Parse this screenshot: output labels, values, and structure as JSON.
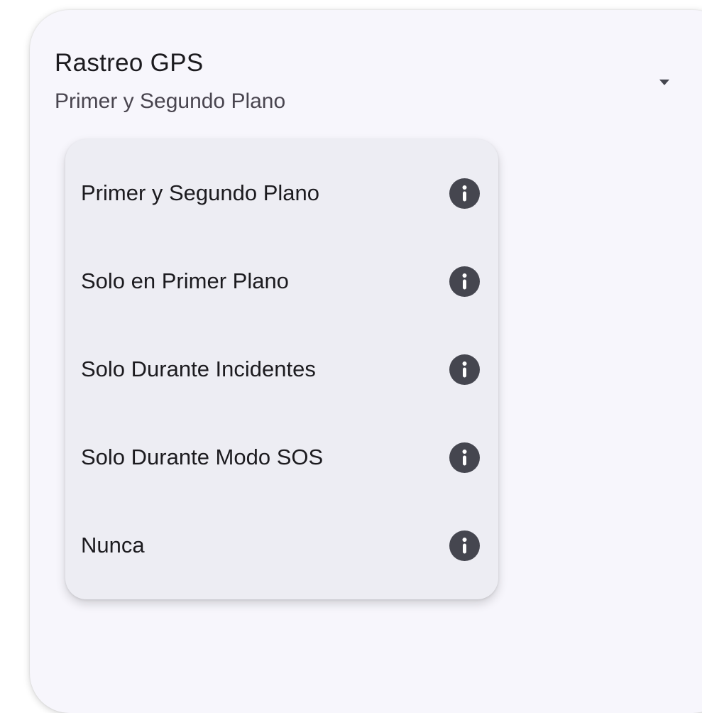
{
  "setting": {
    "title": "Rastreo GPS",
    "selected_value": "Primer y Segundo Plano"
  },
  "dropdown": {
    "icon": "caret-down-icon"
  },
  "menu": {
    "items": [
      {
        "label": "Primer y Segundo Plano",
        "icon": "info-icon"
      },
      {
        "label": "Solo en Primer Plano",
        "icon": "info-icon"
      },
      {
        "label": "Solo Durante Incidentes",
        "icon": "info-icon"
      },
      {
        "label": "Solo Durante Modo SOS",
        "icon": "info-icon"
      },
      {
        "label": "Nunca",
        "icon": "info-icon"
      }
    ]
  },
  "colors": {
    "card_background": "#f7f6fc",
    "menu_background": "#ededf3",
    "text_primary": "#1c1b1f",
    "text_secondary": "#49454f",
    "icon": "#45464f"
  }
}
